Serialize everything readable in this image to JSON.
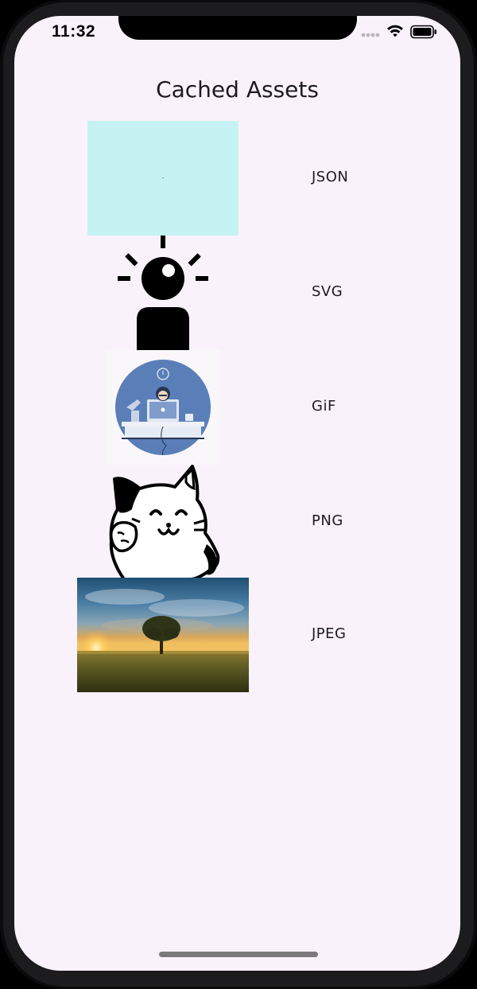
{
  "status_bar": {
    "time": "11:32",
    "icons": [
      "signal-icon",
      "wifi-icon",
      "battery-icon"
    ]
  },
  "page": {
    "title": "Cached Assets",
    "background_color": "#f9f2fa"
  },
  "assets": [
    {
      "label": "JSON",
      "image": "lottie-animation-placeholder"
    },
    {
      "label": "SVG",
      "image": "person-with-idea-bulb-icon"
    },
    {
      "label": "GiF",
      "image": "developer-at-desk-illustration"
    },
    {
      "label": "PNG",
      "image": "waving-lucky-cat-drawing"
    },
    {
      "label": "JPEG",
      "image": "tree-sunset-field-photo"
    }
  ]
}
